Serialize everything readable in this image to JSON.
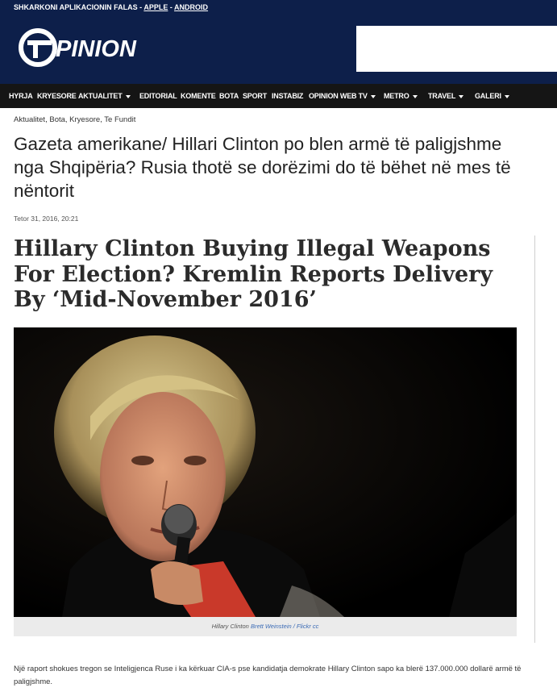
{
  "topbar": {
    "text": "SHKARKONI APLIKACIONIN FALAS - ",
    "apple": "APPLE",
    "sep": " - ",
    "android": "ANDROID"
  },
  "logo": {
    "text": "PINION",
    "alt": "Opinion"
  },
  "nav": {
    "items": [
      {
        "label": "HYRJA"
      },
      {
        "label": "KRYESORE"
      },
      {
        "label": "AKTUALITET"
      },
      {
        "label": "EDITORIAL"
      },
      {
        "label": "KOMENTE"
      },
      {
        "label": "BOTA"
      },
      {
        "label": "SPORT"
      },
      {
        "label": "INSTABIZ"
      },
      {
        "label": "OPINION WEB TV"
      },
      {
        "label": "METRO"
      },
      {
        "label": "TRAVEL"
      },
      {
        "label": "GALERI"
      }
    ]
  },
  "article": {
    "breadcrumb": "Aktualitet, Bota, Kryesore, Te Fundit",
    "headline": "Gazeta amerikane/ Hillari Clinton po blen armë të paligjshme nga Shqipëria? Rusia thotë se dorëzimi do të bëhet në mes të nëntorit",
    "date": "Tetor 31, 2016, 20:21",
    "english_title": "Hillary Clinton Buying Illegal Weapons For Election? Kremlin Reports Delivery By ‘Mid-November 2016’",
    "caption_name": "Hillary Clinton",
    "caption_credit": "Brett Weinstein / Flickr cc",
    "body": "Një raport shokues tregon se Inteligjenca Ruse i ka kërkuar CIA-s pse kandidatja demokrate Hillary Clinton sapo ka blerë 137.000.000 dollarë armë të paligjshme."
  },
  "colors": {
    "header_bg": "#0d1f4a",
    "nav_bg": "#151515",
    "link": "#3b6bb5"
  }
}
